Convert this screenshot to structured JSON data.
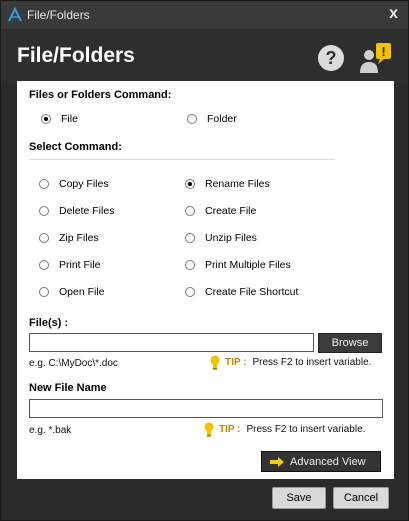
{
  "window": {
    "title": "File/Folders",
    "close_glyph": "x"
  },
  "header": {
    "heading": "File/Folders",
    "help_glyph": "?",
    "alert_glyph": "!"
  },
  "command_type": {
    "label": "Files or Folders Command:",
    "options": [
      {
        "label": "File",
        "checked": true
      },
      {
        "label": "Folder",
        "checked": false
      }
    ]
  },
  "select_command": {
    "label": "Select Command:",
    "options": [
      {
        "label": "Copy Files",
        "checked": false
      },
      {
        "label": "Rename Files",
        "checked": true
      },
      {
        "label": "Delete Files",
        "checked": false
      },
      {
        "label": "Create File",
        "checked": false
      },
      {
        "label": "Zip Files",
        "checked": false
      },
      {
        "label": "Unzip Files",
        "checked": false
      },
      {
        "label": "Print File",
        "checked": false
      },
      {
        "label": "Print Multiple Files",
        "checked": false
      },
      {
        "label": "Open File",
        "checked": false
      },
      {
        "label": "Create File Shortcut",
        "checked": false
      }
    ]
  },
  "files": {
    "label": "File(s) :",
    "value": "",
    "browse_label": "Browse",
    "example": "e.g. C:\\MyDoc\\*.doc",
    "tip_word": "TIP :",
    "tip_text": "Press F2 to insert variable."
  },
  "new_name": {
    "label": "New File Name",
    "value": "",
    "example": "e.g. *.bak",
    "tip_word": "TIP :",
    "tip_text": "Press F2 to insert variable."
  },
  "advanced_label": "Advanced View",
  "footer": {
    "save_label": "Save",
    "cancel_label": "Cancel"
  },
  "colors": {
    "tip_accent": "#b8860b",
    "bulb": "#f2c200",
    "arrow": "#f0d000",
    "alert": "#f2c200"
  }
}
